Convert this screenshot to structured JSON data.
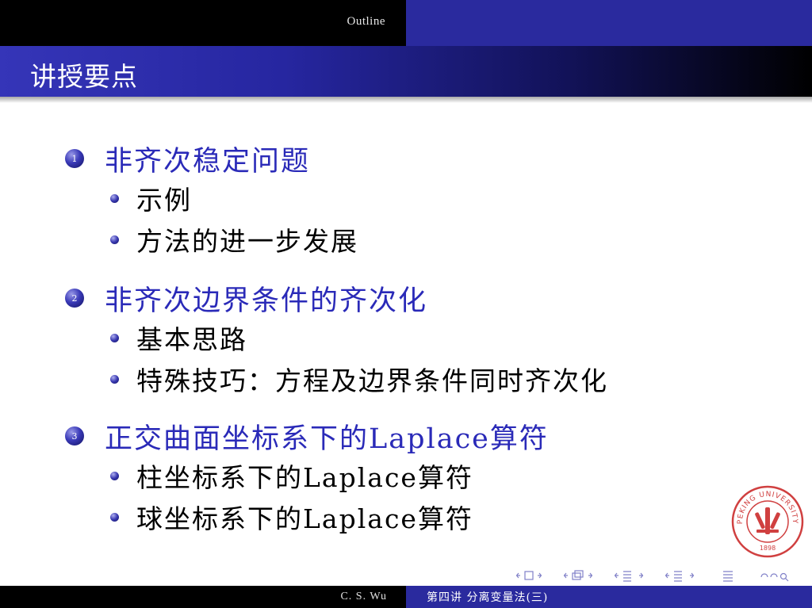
{
  "header": {
    "section_label": "Outline"
  },
  "slide": {
    "title": "讲授要点",
    "sections": [
      {
        "number": "1",
        "heading": "非齐次稳定问题",
        "items": [
          "示例",
          "方法的进一步发展"
        ]
      },
      {
        "number": "2",
        "heading": "非齐次边界条件的齐次化",
        "items": [
          "基本思路",
          "特殊技巧：方程及边界条件同时齐次化"
        ]
      },
      {
        "number": "3",
        "heading": "正交曲面坐标系下的Laplace算符",
        "items": [
          "柱坐标系下的Laplace算符",
          "球坐标系下的Laplace算符"
        ]
      }
    ]
  },
  "footer": {
    "author": "C. S. Wu",
    "lecture": "第四讲  分离变量法(三)"
  },
  "seal": {
    "text": "PEKING UNIVERSITY",
    "year": "1898"
  },
  "colors": {
    "accent": "#2a2ab8",
    "bar_blue": "#2a2a9e",
    "seal_red": "#d04040"
  }
}
